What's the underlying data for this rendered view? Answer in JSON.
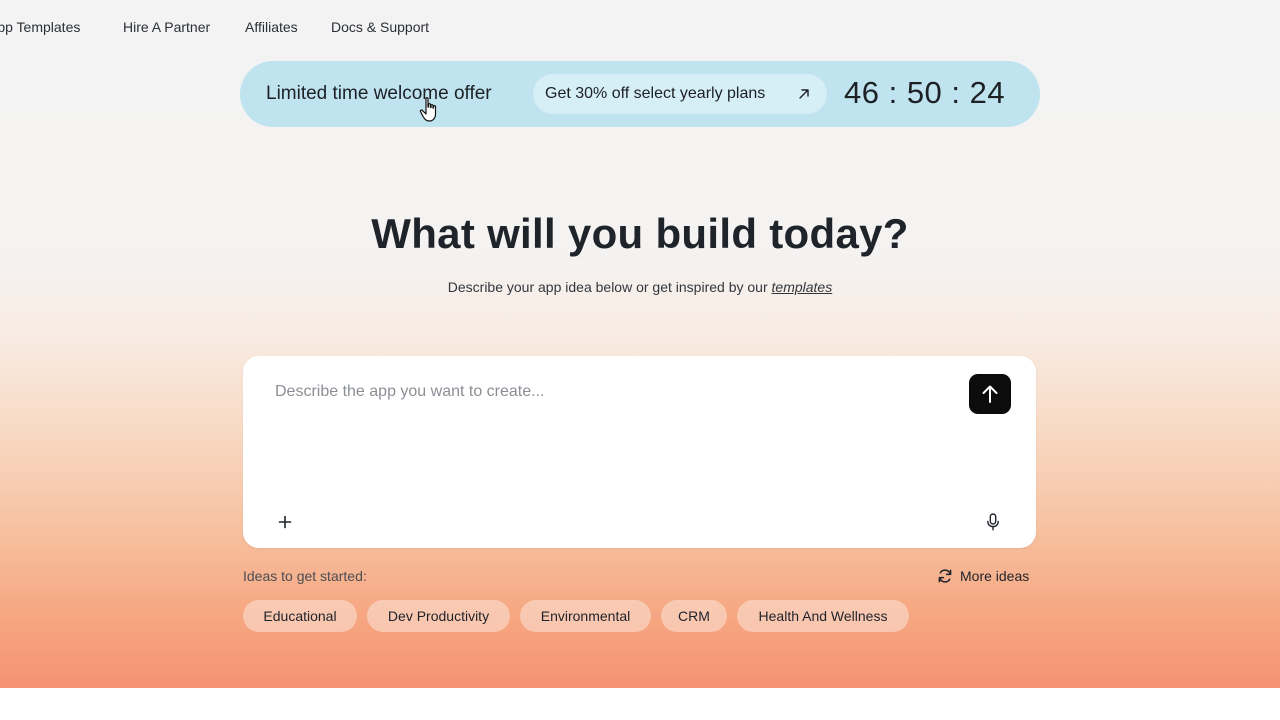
{
  "nav": {
    "items": [
      {
        "label": "App Templates"
      },
      {
        "label": "Hire A Partner"
      },
      {
        "label": "Affiliates"
      },
      {
        "label": "Docs & Support"
      }
    ]
  },
  "promo": {
    "title": "Limited time welcome offer",
    "cta_label": "Get 30% off select yearly plans",
    "countdown": "46 : 50 : 24",
    "bg_color": "#bfe3ef"
  },
  "hero": {
    "headline": "What will you build today?",
    "subline_prefix": "Describe your app idea below or get inspired by our ",
    "subline_link": "templates"
  },
  "prompt": {
    "value": "",
    "placeholder": "Describe the app you want to create..."
  },
  "ideas": {
    "label": "Ideas to get started:",
    "more_label": "More ideas",
    "chips": [
      {
        "label": "Educational"
      },
      {
        "label": "Dev Productivity"
      },
      {
        "label": "Environmental"
      },
      {
        "label": "CRM"
      },
      {
        "label": "Health And Wellness"
      }
    ]
  },
  "icons": {
    "send": "arrow-up-icon",
    "attach": "plus-icon",
    "voice": "microphone-icon",
    "refresh": "refresh-icon",
    "external": "arrow-ne-icon"
  }
}
